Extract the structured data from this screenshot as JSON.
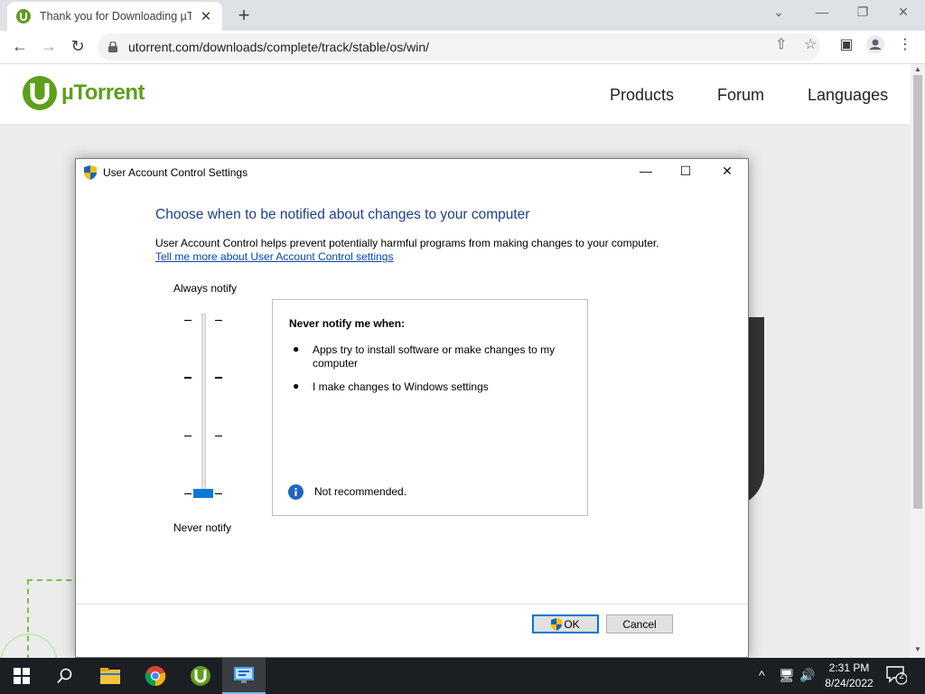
{
  "browser": {
    "tab_title": "Thank you for Downloading µTor",
    "tab_close": "✕",
    "new_tab": "+",
    "url": "utorrent.com/downloads/complete/track/stable/os/win/",
    "window_controls": {
      "dropdown": "⌄",
      "minimize": "—",
      "restore": "❐",
      "close": "✕"
    },
    "nav": {
      "back": "←",
      "forward": "→",
      "reload": "↻"
    },
    "toolbar_icons": {
      "share": "⇧",
      "bookmark": "☆",
      "sidepanel": "▣",
      "profile": "●",
      "menu": "⋮"
    }
  },
  "site": {
    "logo_text": "µTorrent",
    "nav": [
      "Products",
      "Forum",
      "Languages"
    ],
    "brand_color": "#5e9e1d"
  },
  "dialog": {
    "title": "User Account Control Settings",
    "controls": {
      "minimize": "—",
      "maximize": "☐",
      "close": "✕"
    },
    "heading": "Choose when to be notified about changes to your computer",
    "description": "User Account Control helps prevent potentially harmful programs from making changes to your computer.",
    "link": "Tell me more about User Account Control settings",
    "slider": {
      "top_label": "Always notify",
      "bottom_label": "Never notify",
      "level": 0,
      "levels": 4
    },
    "info": {
      "heading": "Never notify me when:",
      "bullets": [
        "Apps try to install software or make changes to my computer",
        "I make changes to Windows settings"
      ],
      "note": "Not recommended."
    },
    "buttons": {
      "ok": "OK",
      "cancel": "Cancel"
    }
  },
  "taskbar": {
    "apps": [
      "start",
      "search",
      "file-explorer",
      "chrome",
      "utorrent",
      "uac-settings"
    ],
    "time": "2:31 PM",
    "date": "8/24/2022",
    "notification_count": "2"
  }
}
